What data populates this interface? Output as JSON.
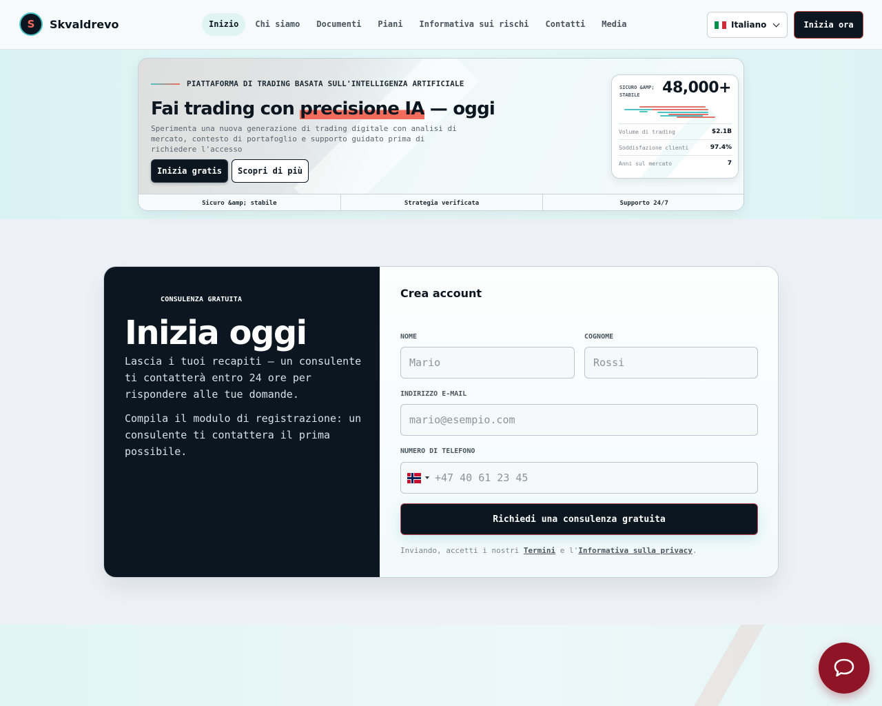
{
  "brand": {
    "name": "Skvaldrevo",
    "logo_letter": "S"
  },
  "nav": {
    "items": [
      "Inizio",
      "Chi siamo",
      "Documenti",
      "Piani",
      "Informativa sui rischi",
      "Contatti",
      "Media"
    ],
    "active": "Inizio"
  },
  "language": {
    "label": "Italiano",
    "flag_icon": "italy-flag-icon"
  },
  "header_cta": "Inizia ora",
  "hero": {
    "eyebrow": "PIATTAFORMA DI TRADING BASATA SULL'INTELLIGENZA ARTIFICIALE",
    "title_pre": "Fai trading con ",
    "title_highlight": "precisione IA",
    "title_post": " — oggi",
    "description": "Sperimenta una nuova generazione di trading digitale con analisi di mercato, contesto di portafoglio e supporto guidato prima di richiedere l'accesso",
    "primary_button": "Inizia gratis",
    "secondary_button": "Scopri di più",
    "stats": {
      "label": "SICURO &AMP; STABILE",
      "big_number": "48,000+",
      "rows": [
        {
          "key": "Volume di trading",
          "value": "$2.1B"
        },
        {
          "key": "Soddisfazione clienti",
          "value": "97.4%"
        },
        {
          "key": "Anni sul mercato",
          "value": "7"
        }
      ]
    },
    "tabs": [
      "Sicuro &amp; stabile",
      "Strategia verificata",
      "Supporto 24/7"
    ]
  },
  "signup": {
    "kicker": "CONSULENZA GRATUITA",
    "title": "Inizia oggi",
    "lead": "Lascia i tuoi recapiti — un consulente ti contatterà entro 24 ore per rispondere alle tue domande.",
    "lead2": "Compila il modulo di registrazione: un consulente ti contattera il prima possibile.",
    "form_title": "Crea account",
    "first_name": {
      "label": "NOME",
      "placeholder": "Mario"
    },
    "last_name": {
      "label": "COGNOME",
      "placeholder": "Rossi"
    },
    "email": {
      "label": "INDIRIZZO E-MAIL",
      "placeholder": "mario@esempio.com"
    },
    "phone": {
      "label": "NUMERO DI TELEFONO",
      "placeholder": "+47 40 61 23 45",
      "country_flag": "norway-flag-icon"
    },
    "submit": "Richiedi una consulenza gratuita",
    "legal_pre": "Inviando, accetti i nostri ",
    "terms_link": "Termini",
    "legal_mid": " e l'",
    "privacy_link": "Informativa sulla privacy",
    "legal_post": "."
  },
  "chat": {
    "icon": "chat-bubble-icon"
  },
  "colors": {
    "accent_teal": "#4cc3c6",
    "accent_coral": "#f26b5b",
    "dark": "#0b1620",
    "chat": "#8e1426"
  }
}
